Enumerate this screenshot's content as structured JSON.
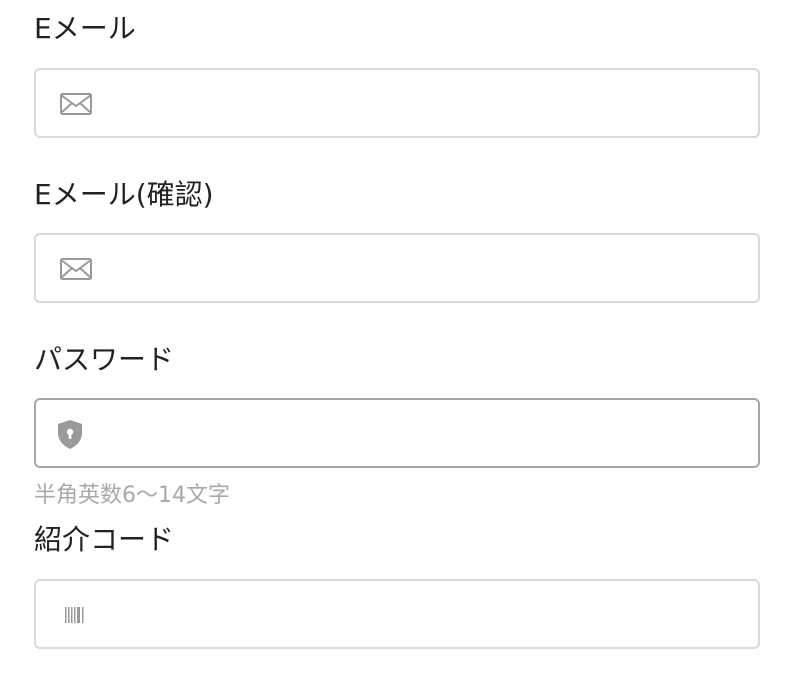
{
  "fields": {
    "email": {
      "label": "Eメール",
      "value": "",
      "icon": "envelope-icon"
    },
    "email_confirm": {
      "label": "Eメール(確認)",
      "value": "",
      "icon": "envelope-icon"
    },
    "password": {
      "label": "パスワード",
      "value": "",
      "icon": "shield-lock-icon",
      "hint": "半角英数6〜14文字"
    },
    "referral_code": {
      "label": "紹介コード",
      "value": "",
      "icon": "barcode-icon"
    }
  },
  "colors": {
    "label_text": "#222222",
    "hint_text": "#a9a9a9",
    "input_border": "#d9d9d9",
    "input_border_focused": "#a6a6a6",
    "icon_color": "#9a9a9a"
  }
}
